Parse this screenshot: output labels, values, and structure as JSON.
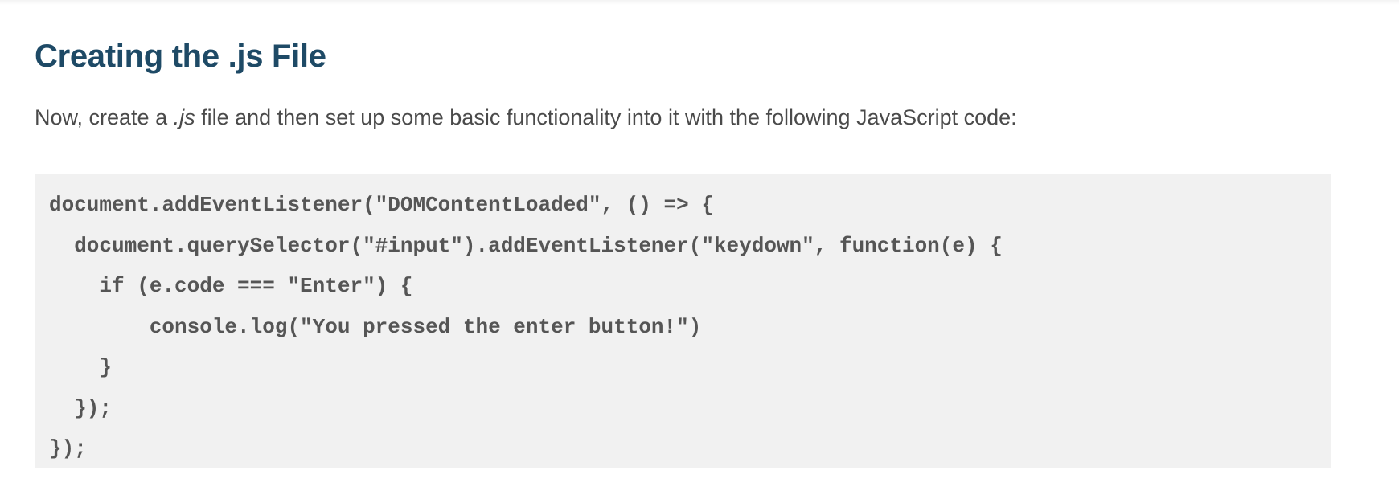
{
  "article": {
    "heading": "Creating the .js File",
    "intro": {
      "before": "Now, create a ",
      "emphasis": ".js",
      "after": " file and then set up some basic functionality into it with the following JavaScript code:"
    },
    "code_lines": [
      "document.addEventListener(\"DOMContentLoaded\", () => {",
      "  document.querySelector(\"#input\").addEventListener(\"keydown\", function(e) {",
      "    if (e.code === \"Enter\") {",
      "        console.log(\"You pressed the enter button!\")",
      "    }",
      "  });",
      "});"
    ]
  }
}
